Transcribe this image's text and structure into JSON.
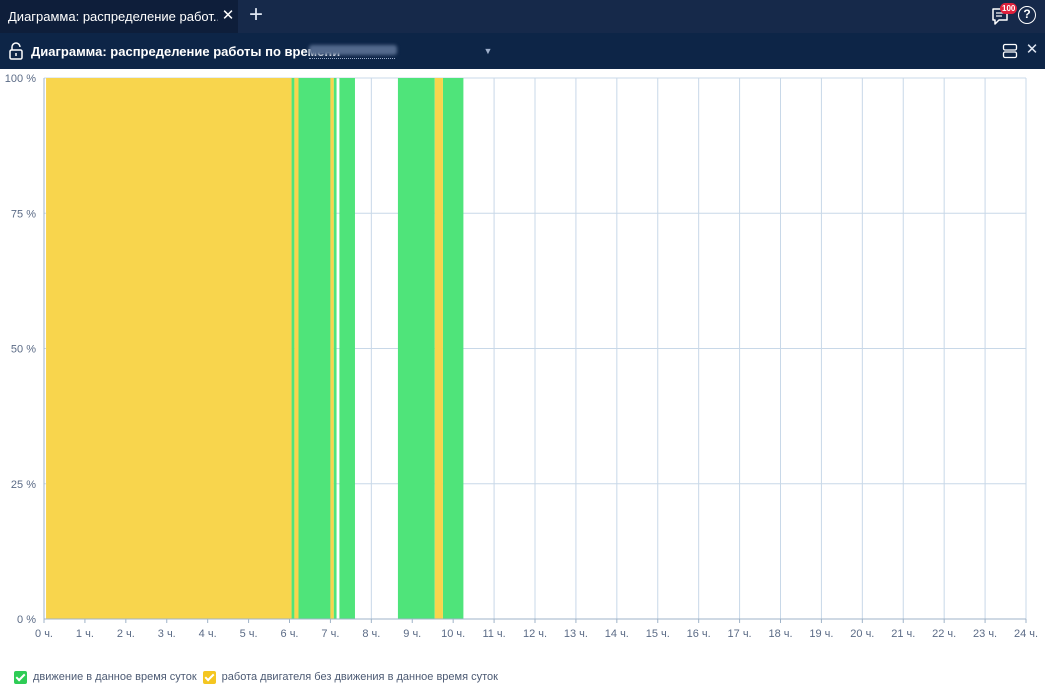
{
  "tabbar": {
    "active_tab_label": "Диаграмма: распределение работ...",
    "notifications_count": "100",
    "help_label": "?"
  },
  "header": {
    "title": "Диаграмма: распределение работы по времени",
    "lock_icon": "lock-open-icon",
    "layout_icon": "split-layout-icon",
    "close_icon": "close-icon"
  },
  "colors": {
    "movement": "#4fe47a",
    "idle_engine": "#f8d54d",
    "grid": "#c8d8e8",
    "axis": "#9fb3c8",
    "legend_movement": "#2ecc55",
    "legend_idle": "#f4c621"
  },
  "chart_data": {
    "type": "area",
    "title": "",
    "xlabel": "",
    "ylabel": "",
    "x_ticks": [
      "0 ч.",
      "1 ч.",
      "2 ч.",
      "3 ч.",
      "4 ч.",
      "5 ч.",
      "6 ч.",
      "7 ч.",
      "8 ч.",
      "9 ч.",
      "10 ч.",
      "11 ч.",
      "12 ч.",
      "13 ч.",
      "14 ч.",
      "15 ч.",
      "16 ч.",
      "17 ч.",
      "18 ч.",
      "19 ч.",
      "20 ч.",
      "21 ч.",
      "22 ч.",
      "23 ч.",
      "24 ч."
    ],
    "y_ticks": [
      "0 %",
      "25 %",
      "50 %",
      "75 %",
      "100 %"
    ],
    "xlim": [
      0,
      24
    ],
    "ylim": [
      0,
      100
    ],
    "grid": true,
    "legend_position": "bottom-left",
    "series": [
      {
        "name": "движение в данное время суток",
        "color_key": "movement",
        "segments": [
          {
            "start": 6.05,
            "end": 6.12,
            "value": 100
          },
          {
            "start": 6.22,
            "end": 7.0,
            "value": 100
          },
          {
            "start": 7.08,
            "end": 7.15,
            "value": 100
          },
          {
            "start": 7.22,
            "end": 7.6,
            "value": 100
          },
          {
            "start": 8.65,
            "end": 9.55,
            "value": 100
          },
          {
            "start": 9.75,
            "end": 10.25,
            "value": 100
          }
        ]
      },
      {
        "name": "работа двигателя без движения в данное время суток",
        "color_key": "idle_engine",
        "segments": [
          {
            "start": 0.05,
            "end": 6.05,
            "value": 100
          },
          {
            "start": 6.12,
            "end": 6.22,
            "value": 100
          },
          {
            "start": 7.0,
            "end": 7.08,
            "value": 100
          },
          {
            "start": 9.55,
            "end": 9.75,
            "value": 100
          }
        ]
      }
    ]
  }
}
